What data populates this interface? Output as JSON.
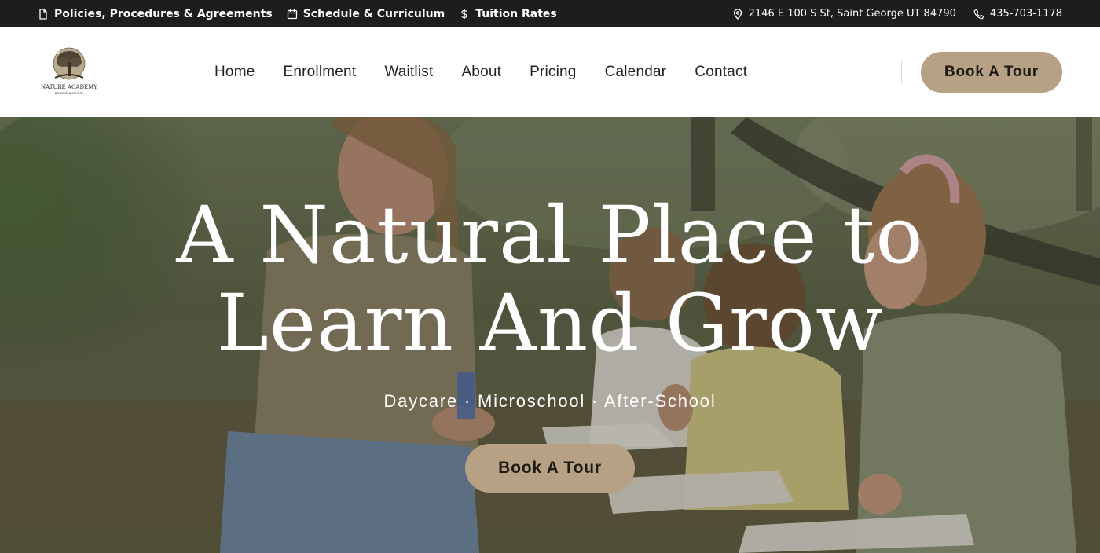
{
  "topbar": {
    "links": [
      {
        "label": "Policies, Procedures & Agreements",
        "icon": "document-icon"
      },
      {
        "label": "Schedule & Curriculum",
        "icon": "calendar-icon"
      },
      {
        "label": "Tuition Rates",
        "icon": "dollar-icon"
      }
    ],
    "address": "2146 E 100 S St, Saint George UT 84790",
    "phone": "435-703-1178"
  },
  "logo": {
    "line1": "NATURE ACADEMY",
    "line2": "DAYCARE & SCHOOL"
  },
  "nav": {
    "items": [
      "Home",
      "Enrollment",
      "Waitlist",
      "About",
      "Pricing",
      "Calendar",
      "Contact"
    ]
  },
  "header": {
    "cta_label": "Book A Tour"
  },
  "hero": {
    "title_line1": "A Natural Place to",
    "title_line2": "Learn And Grow",
    "subtitle": "Daycare · Microschool · After-School",
    "cta_label": "Book A Tour"
  },
  "colors": {
    "topbar_bg": "#1d1d1d",
    "accent": "#b7a184",
    "nav_text": "#222222"
  }
}
